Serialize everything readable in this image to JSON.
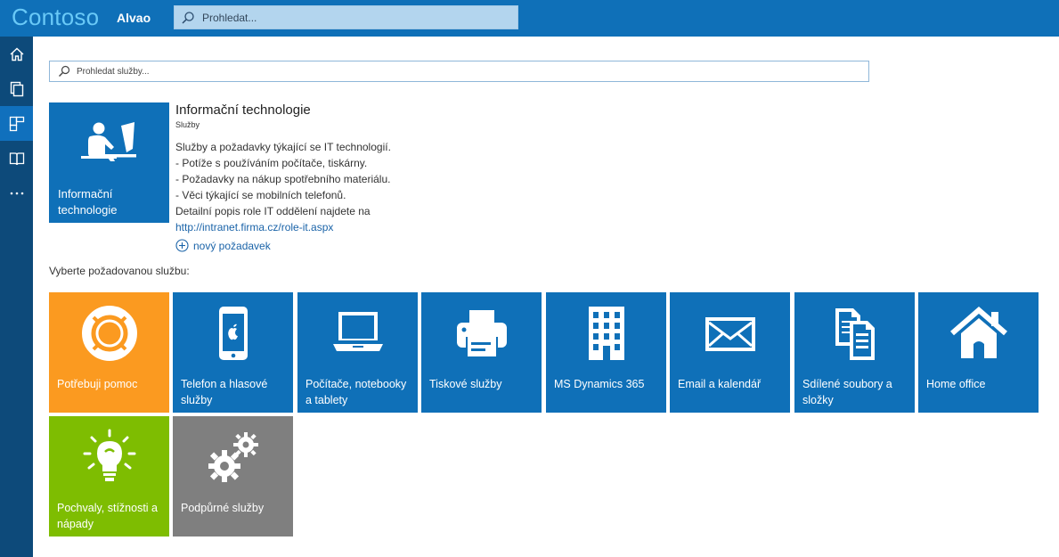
{
  "header": {
    "brand": "Contoso",
    "product": "Alvao",
    "search_placeholder": "Prohledat..."
  },
  "sidenav": {
    "items": [
      {
        "icon": "home-icon"
      },
      {
        "icon": "copy-icon"
      },
      {
        "icon": "dashboard-icon",
        "active": true
      },
      {
        "icon": "book-icon"
      },
      {
        "icon": "more-icon"
      }
    ]
  },
  "service_search": {
    "placeholder": "Prohledat služby..."
  },
  "category": {
    "tile_label": "Informační technologie",
    "title": "Informační technologie",
    "subtitle": "Služby",
    "description_lines": [
      "Služby a požadavky týkající se IT technologií.",
      "- Potíže s používáním počítače, tiskárny.",
      "- Požadavky na nákup spotřebního materiálu.",
      "- Věci týkající se mobilních telefonů.",
      "Detailní popis role IT oddělení najdete na"
    ],
    "link": "http://intranet.firma.cz/role-it.aspx",
    "new_request": "nový požadavek"
  },
  "choose_label": "Vyberte požadovanou službu:",
  "services": [
    {
      "label": "Potřebuji pomoc",
      "icon": "lifebuoy-icon",
      "color": "#fb9a20"
    },
    {
      "label": "Telefon a hlasové služby",
      "icon": "phone-icon",
      "color": "#0f70b8"
    },
    {
      "label": "Počítače, notebooky a tablety",
      "icon": "laptop-icon",
      "color": "#0f70b8"
    },
    {
      "label": "Tiskové služby",
      "icon": "printer-icon",
      "color": "#0f70b8"
    },
    {
      "label": "MS Dynamics 365",
      "icon": "building-icon",
      "color": "#0f70b8"
    },
    {
      "label": "Email a kalendář",
      "icon": "envelope-icon",
      "color": "#0f70b8"
    },
    {
      "label": "Sdílené soubory a složky",
      "icon": "documents-icon",
      "color": "#0f70b8"
    },
    {
      "label": "Home office",
      "icon": "house-icon",
      "color": "#0f70b8"
    },
    {
      "label": "Pochvaly, stížnosti a nápady",
      "icon": "lightbulb-icon",
      "color": "#7ebd01"
    },
    {
      "label": "Podpůrné služby",
      "icon": "gears-icon",
      "color": "#7f7f7f"
    }
  ]
}
